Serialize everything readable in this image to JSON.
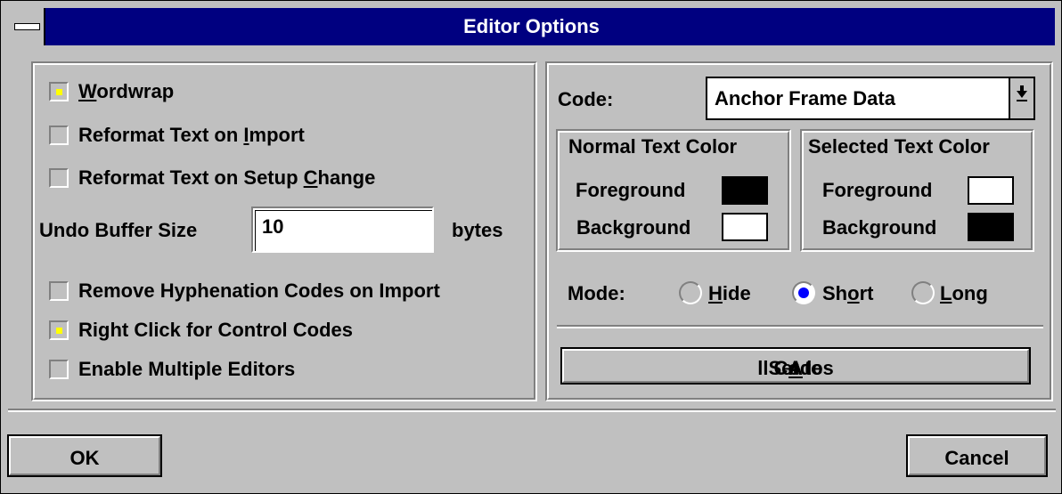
{
  "window": {
    "title": "Editor Options"
  },
  "left": {
    "wordwrap": {
      "label_pre": "",
      "label_u": "W",
      "label_post": "ordwrap",
      "checked": true
    },
    "reformat_import": {
      "label_pre": "Reformat Text on ",
      "label_u": "I",
      "label_post": "mport",
      "checked": false
    },
    "reformat_setup": {
      "label_pre": "Reformat Text on Setup ",
      "label_u": "C",
      "label_post": "hange",
      "checked": false
    },
    "undo": {
      "label": "Undo Buffer Size",
      "value": "10",
      "unit": "bytes"
    },
    "remove_hyphen": {
      "label": "Remove Hyphenation Codes on Import",
      "checked": false
    },
    "right_click": {
      "label": "Right Click for Control Codes",
      "checked": true
    },
    "multiple_editors": {
      "label": "Enable Multiple Editors",
      "checked": false
    }
  },
  "right": {
    "code_label": "Code:",
    "code_value": "Anchor Frame Data",
    "dropdown_icon": "down-arrow-icon",
    "normal": {
      "title": "Normal Text Color",
      "fg_label": "Foreground",
      "bg_label": "Background",
      "fg_color": "#000000",
      "bg_color": "#ffffff"
    },
    "selected": {
      "title": "Selected Text Color",
      "fg_label": "Foreground",
      "bg_label": "Background",
      "fg_color": "#ffffff",
      "bg_color": "#000000"
    },
    "mode_label": "Mode:",
    "modes": [
      {
        "pre": "",
        "u": "H",
        "post": "ide",
        "selected": false
      },
      {
        "pre": "Sh",
        "u": "o",
        "post": "rt",
        "selected": true
      },
      {
        "pre": "",
        "u": "L",
        "post": "ong",
        "selected": false
      }
    ],
    "set_all": {
      "pre": "Set to ",
      "u": "A",
      "post": "ll Codes"
    }
  },
  "footer": {
    "ok": "OK",
    "cancel": "Cancel"
  }
}
